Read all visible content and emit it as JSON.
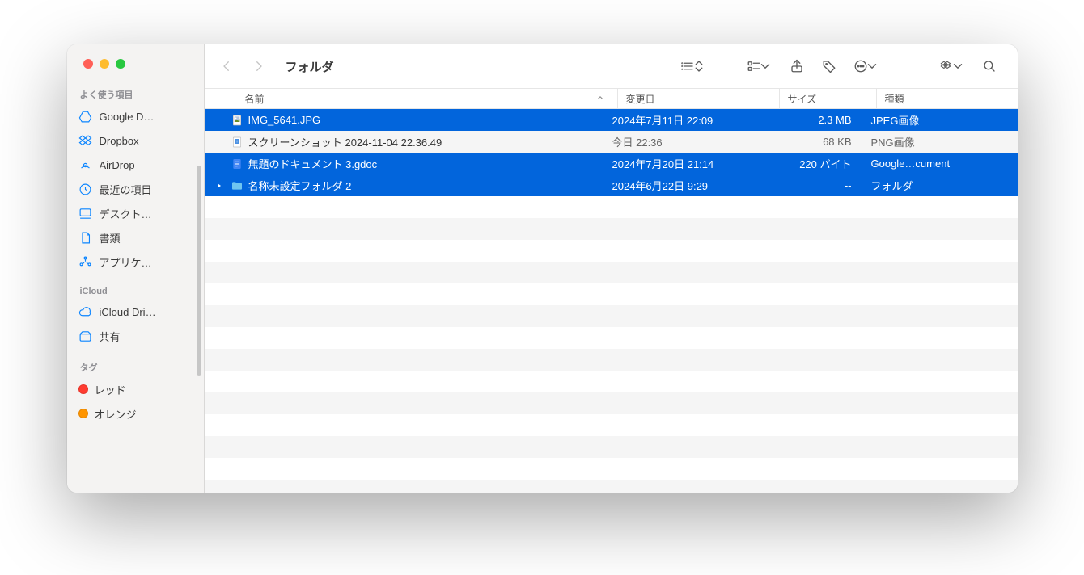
{
  "window": {
    "title": "フォルダ"
  },
  "sidebar": {
    "sections": [
      {
        "title": "よく使う項目",
        "items": [
          {
            "icon": "gdrive",
            "label": "Google D…"
          },
          {
            "icon": "dropbox",
            "label": "Dropbox"
          },
          {
            "icon": "airdrop",
            "label": "AirDrop"
          },
          {
            "icon": "clock",
            "label": "最近の項目"
          },
          {
            "icon": "desktop",
            "label": "デスクト…"
          },
          {
            "icon": "doc",
            "label": "書類"
          },
          {
            "icon": "apps",
            "label": "アプリケ…"
          }
        ]
      },
      {
        "title": "iCloud",
        "items": [
          {
            "icon": "cloud",
            "label": "iCloud Dri…"
          },
          {
            "icon": "shared",
            "label": "共有"
          }
        ]
      },
      {
        "title": "タグ",
        "items": [
          {
            "icon": "tag-red",
            "label": "レッド"
          },
          {
            "icon": "tag-orange",
            "label": "オレンジ"
          }
        ]
      }
    ]
  },
  "columns": {
    "name": "名前",
    "date": "変更日",
    "size": "サイズ",
    "kind": "種類"
  },
  "files": [
    {
      "selected": true,
      "disclosure": false,
      "icon": "jpg",
      "name": "IMG_5641.JPG",
      "date": "2024年7月11日 22:09",
      "size": "2.3 MB",
      "kind": "JPEG画像"
    },
    {
      "selected": false,
      "disclosure": false,
      "icon": "png",
      "name": "スクリーンショット 2024-11-04 22.36.49",
      "date": "今日 22:36",
      "size": "68 KB",
      "kind": "PNG画像"
    },
    {
      "selected": true,
      "disclosure": false,
      "icon": "gdoc",
      "name": "無題のドキュメント 3.gdoc",
      "date": "2024年7月20日 21:14",
      "size": "220 バイト",
      "kind": "Google…cument"
    },
    {
      "selected": true,
      "disclosure": true,
      "icon": "folder",
      "name": "名称未設定フォルダ 2",
      "date": "2024年6月22日 9:29",
      "size": "--",
      "kind": "フォルダ"
    }
  ],
  "colors": {
    "selection": "#0265dc",
    "accent": "#0a84ff",
    "tagRed": "#ff3b30",
    "tagOrange": "#ff9500"
  }
}
